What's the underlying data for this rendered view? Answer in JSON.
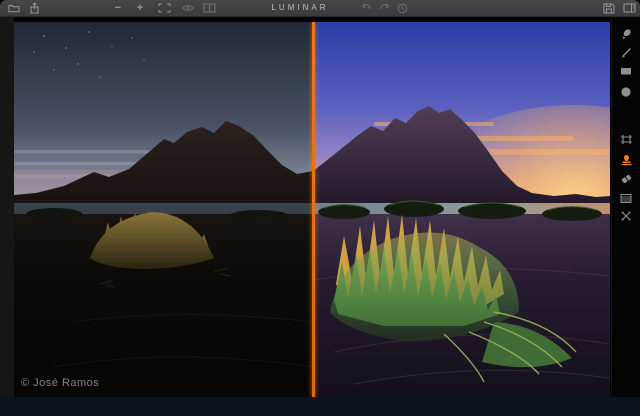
{
  "app": {
    "title": "LUMINAR"
  },
  "topbar": {
    "zoom_out_label": "−",
    "zoom_in_label": "+",
    "left_icons": [
      "open-folder-icon",
      "export-share-icon"
    ],
    "view_icons": [
      "zoom-out-button",
      "zoom-in-button",
      "fit-screen-icon",
      "quick-preview-eye-icon",
      "before-after-split-icon"
    ],
    "history_icons": [
      "undo-icon",
      "redo-icon",
      "history-icon"
    ],
    "right_icons": [
      "save-icon",
      "side-panel-toggle-icon"
    ]
  },
  "sidebar": {
    "tools": [
      {
        "name": "brush-tool",
        "active": false
      },
      {
        "name": "gradient-line-tool",
        "active": false
      },
      {
        "name": "linear-mask-tool",
        "active": false
      },
      {
        "name": "radial-mask-tool",
        "active": false
      },
      {
        "name": "crop-tool",
        "active": false
      },
      {
        "name": "clone-stamp-tool",
        "active": true
      },
      {
        "name": "erase-tool",
        "active": false
      },
      {
        "name": "denoise-tool",
        "active": false
      },
      {
        "name": "free-transform-tool",
        "active": false
      }
    ]
  },
  "photo": {
    "watermark": "© José Ramos",
    "description": "Before/after split of Vestrahorn mountain black-sand beach at sunset"
  },
  "colors": {
    "topbar_bg": "#3f3f44",
    "accent_orange": "#e8791c",
    "active_tool_orange": "#e8821c",
    "icon_gray": "#97989d",
    "canvas_bg": "#000000",
    "bottom_strip": "#08131c",
    "title_text": "#bcbdc4",
    "watermark_text": "#85858a"
  }
}
